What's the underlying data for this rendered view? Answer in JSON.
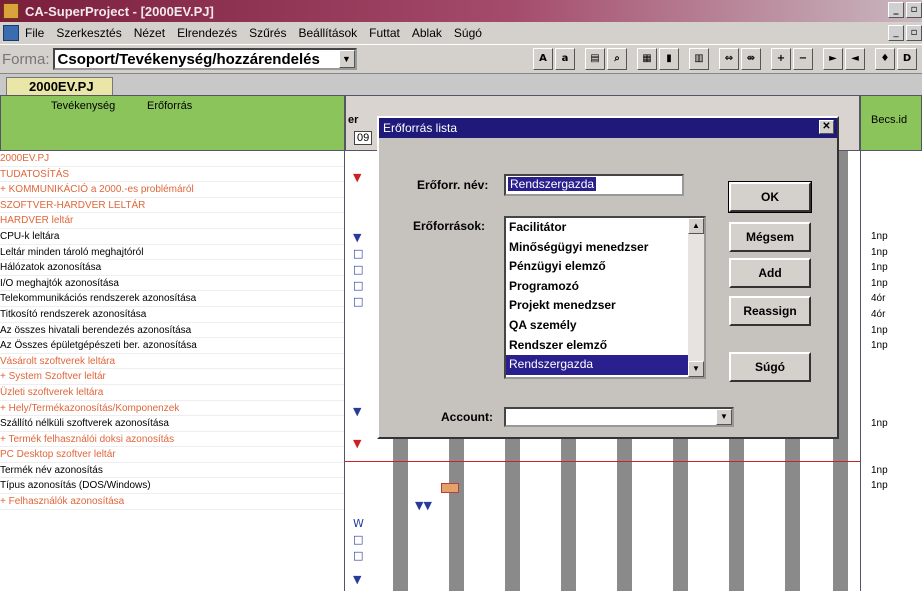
{
  "window": {
    "title": "CA-SuperProject - [2000EV.PJ]"
  },
  "menu": [
    "File",
    "Szerkesztés",
    "Nézet",
    "Elrendezés",
    "Szűrés",
    "Beállítások",
    "Futtat",
    "Ablak",
    "Súgó"
  ],
  "toolbar": {
    "forma_label": "Forma:",
    "forma_value": "Csoport/Tevékenység/hozzárendelés"
  },
  "doc_tab": "2000EV.PJ",
  "grid": {
    "col_activity": "Tevékenység",
    "col_resource": "Erőforrás",
    "gantt_header_fragment": "er",
    "gantt_header_date": "09",
    "col_estimate": "Becs.id"
  },
  "tasks": [
    {
      "text": "2000EV.PJ",
      "style": "orange",
      "estimate": ""
    },
    {
      "text": " TUDATOSÍTÁS",
      "style": "orange",
      "estimate": ""
    },
    {
      "text": "+ KOMMUNIKÁCIÓ a 2000.-es problémáról",
      "style": "orange",
      "estimate": ""
    },
    {
      "text": " SZOFTVER-HARDVER LELTÁR",
      "style": "orange",
      "estimate": ""
    },
    {
      "text": "   HARDVER leltár",
      "style": "orange",
      "estimate": ""
    },
    {
      "text": "     CPU-k leltára",
      "style": "black",
      "estimate": "1np"
    },
    {
      "text": "     Leltár minden tároló meghajtóról",
      "style": "black",
      "estimate": "1np"
    },
    {
      "text": "     Hálózatok azonosítása",
      "style": "black",
      "estimate": "1np"
    },
    {
      "text": "     I/O meghajtók azonosítása",
      "style": "black",
      "estimate": "1np"
    },
    {
      "text": "     Telekommunikációs rendszerek azonosítása",
      "style": "black",
      "estimate": "4ór"
    },
    {
      "text": "     Titkosító rendszerek azonosítása",
      "style": "black",
      "estimate": "4ór"
    },
    {
      "text": "     Az összes hivatali berendezés azonosítása",
      "style": "black",
      "estimate": "1np"
    },
    {
      "text": "     Az Összes épületgépészeti ber. azonosítása",
      "style": "black",
      "estimate": "1np"
    },
    {
      "text": "   Vásárolt szoftverek leltára",
      "style": "orange",
      "estimate": ""
    },
    {
      "text": "+    System Szoftver leltár",
      "style": "orange",
      "estimate": ""
    },
    {
      "text": "   Üzleti szoftverek leltára",
      "style": "orange",
      "estimate": ""
    },
    {
      "text": "+    Hely/Termékazonosítás/Komponenzek",
      "style": "orange",
      "estimate": ""
    },
    {
      "text": "     Szállító nélküli szoftverek azonosítása",
      "style": "black",
      "estimate": "1np"
    },
    {
      "text": "+    Termék felhasználói doksi azonosítás",
      "style": "orange",
      "estimate": ""
    },
    {
      "text": "   PC Desktop szoftver leltár",
      "style": "orange",
      "estimate": ""
    },
    {
      "text": "     Termék név azonosítás",
      "style": "black",
      "estimate": "1np"
    },
    {
      "text": "     Típus azonosítás (DOS/Windows)",
      "style": "black",
      "estimate": "1np"
    },
    {
      "text": "+    Felhasználók azonosítása",
      "style": "orange",
      "estimate": ""
    }
  ],
  "dialog": {
    "title": "Erőforrás lista",
    "name_label": "Erőforr. név:",
    "name_value": "Rendszergazda",
    "list_label": "Erőforrások:",
    "resources": [
      "Facilitátor",
      "Minőségügyi menedzser",
      "Pénzügyi elemző",
      "Programozó",
      "Projekt menedzser",
      "QA személy",
      "Rendszer elemző",
      "Rendszergazda"
    ],
    "selected_resource": "Rendszergazda",
    "account_label": "Account:",
    "account_value": "",
    "buttons": {
      "ok": "OK",
      "cancel": "Mégsem",
      "add": "Add",
      "reassign": "Reassign",
      "help": "Súgó"
    }
  },
  "colors": {
    "title_bar": "#7a1e3c",
    "header_green": "#8cc45c",
    "dialog_title": "#1f1a7a",
    "selection": "#2a1f8e",
    "orange_task": "#e0663a"
  }
}
